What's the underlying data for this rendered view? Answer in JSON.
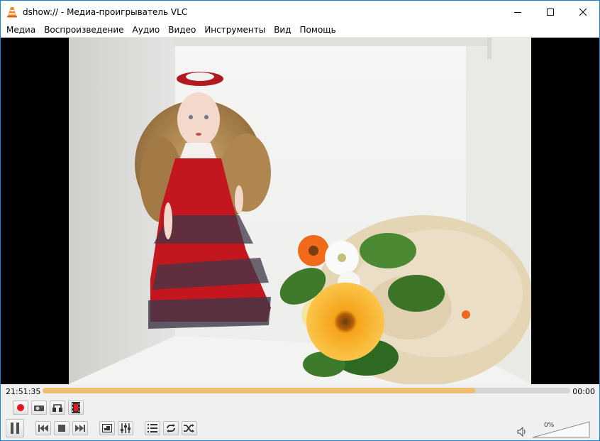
{
  "window": {
    "title": "dshow:// - Медиа-проигрыватель VLC"
  },
  "menu": [
    {
      "label": "Медиа"
    },
    {
      "label": "Воспроизведение"
    },
    {
      "label": "Аудио"
    },
    {
      "label": "Видео"
    },
    {
      "label": "Инструменты"
    },
    {
      "label": "Вид"
    },
    {
      "label": "Помощь"
    }
  ],
  "seek": {
    "elapsed": "21:51:35",
    "total": "00:00",
    "progress": 0.82,
    "fill_color": "#f0be6f"
  },
  "controls": {
    "advanced": [
      "record-icon",
      "snapshot-icon",
      "loop-ab-icon",
      "frame-step-icon"
    ],
    "main": [
      "pause-icon",
      "previous-icon",
      "stop-icon",
      "next-icon",
      "fullscreen-icon",
      "extended-settings-icon",
      "playlist-icon",
      "loop-icon",
      "shuffle-icon"
    ]
  },
  "volume": {
    "label": "0%",
    "level": 0
  },
  "colors": {
    "accent": "#1883d7",
    "record": "#e8141e",
    "frame_bg": "#ebebe9"
  }
}
